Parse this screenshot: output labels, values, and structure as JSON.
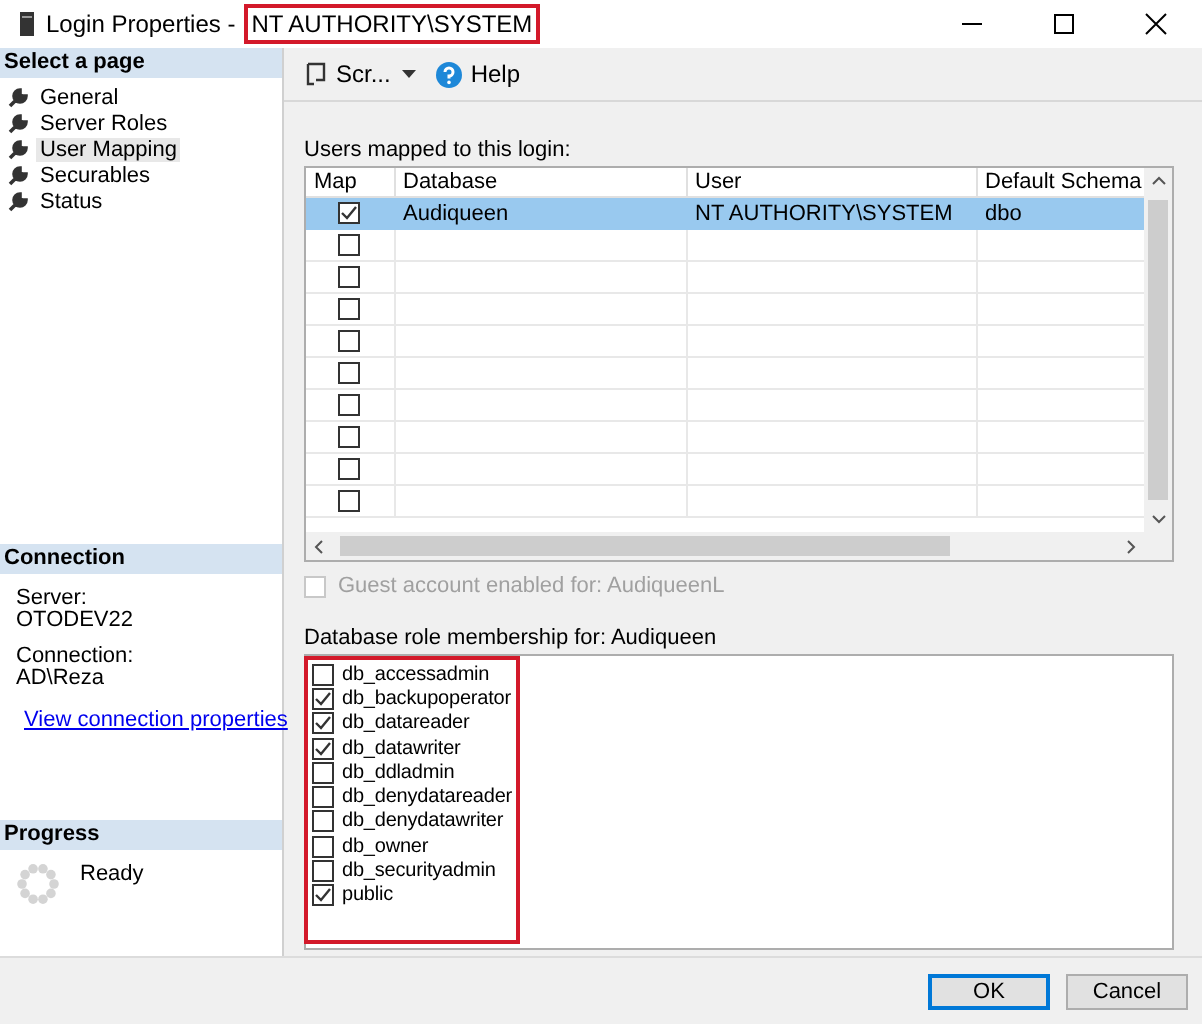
{
  "window": {
    "title": "Login Properties -",
    "login": "NT AUTHORITY\\SYSTEM",
    "login_highlighted": true
  },
  "sidebar": {
    "header": "Select a page",
    "items": [
      {
        "label": "General",
        "selected": false
      },
      {
        "label": "Server Roles",
        "selected": false
      },
      {
        "label": "User Mapping",
        "selected": true
      },
      {
        "label": "Securables",
        "selected": false
      },
      {
        "label": "Status",
        "selected": false
      }
    ]
  },
  "connection": {
    "header": "Connection",
    "server_label": "Server:",
    "server": "OTODEV22",
    "connection_label": "Connection:",
    "connection": "AD\\Reza",
    "link": "View connection properties"
  },
  "progress": {
    "header": "Progress",
    "status": "Ready"
  },
  "toolbar": {
    "script": "Scr...",
    "help": "Help"
  },
  "users": {
    "label": "Users mapped to this login:",
    "columns": [
      "Map",
      "Database",
      "User",
      "Default Schema"
    ],
    "rows": [
      {
        "map": true,
        "database": "Audiqueen",
        "user": "NT AUTHORITY\\SYSTEM",
        "schema": "dbo",
        "selected": true
      },
      {
        "map": false,
        "selected": false
      },
      {
        "map": false,
        "selected": false
      },
      {
        "map": false,
        "selected": false
      },
      {
        "map": false,
        "selected": false
      },
      {
        "map": false,
        "selected": false
      },
      {
        "map": false,
        "selected": false
      },
      {
        "map": false,
        "selected": false
      },
      {
        "map": false,
        "selected": false
      },
      {
        "map": false,
        "selected": false
      }
    ]
  },
  "guest": {
    "label": "Guest account enabled for: AudiqueenL",
    "checked": false,
    "disabled": true
  },
  "roles": {
    "label": "Database role membership for: Audiqueen",
    "highlighted": true,
    "items": [
      {
        "label": "db_accessadmin",
        "checked": false
      },
      {
        "label": "db_backupoperator",
        "checked": true
      },
      {
        "label": "db_datareader",
        "checked": true
      },
      {
        "label": "db_datawriter",
        "checked": true
      },
      {
        "label": "db_ddladmin",
        "checked": false
      },
      {
        "label": "db_denydatareader",
        "checked": false
      },
      {
        "label": "db_denydatawriter",
        "checked": false
      },
      {
        "label": "db_owner",
        "checked": false
      },
      {
        "label": "db_securityadmin",
        "checked": false
      },
      {
        "label": "public",
        "checked": true
      }
    ]
  },
  "buttons": [
    {
      "label": "OK",
      "default": true
    },
    {
      "label": "Cancel",
      "default": false
    }
  ]
}
